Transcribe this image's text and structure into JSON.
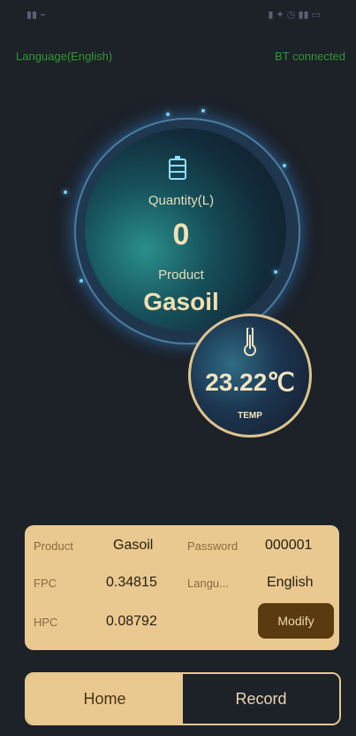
{
  "app": {
    "language_link": "Language(English)",
    "bt_status": "BT connected"
  },
  "dashboard": {
    "quantity_label": "Quantity(L)",
    "quantity_value": "0",
    "product_label": "Product",
    "product_value": "Gasoil",
    "temperature_value": "23.22℃",
    "temperature_label": "TEMP"
  },
  "info": {
    "product_label": "Product",
    "product_value": "Gasoil",
    "password_label": "Password",
    "password_value": "000001",
    "fpc_label": "FPC",
    "fpc_value": "0.34815",
    "language_label": "Langu...",
    "language_value": "English",
    "hpc_label": "HPC",
    "hpc_value": "0.08792",
    "modify_label": "Modify"
  },
  "nav": {
    "home_label": "Home",
    "record_label": "Record"
  },
  "colors": {
    "background": "#1d2128",
    "accent": "#e9c98f",
    "status_green": "#2e9a2e"
  }
}
